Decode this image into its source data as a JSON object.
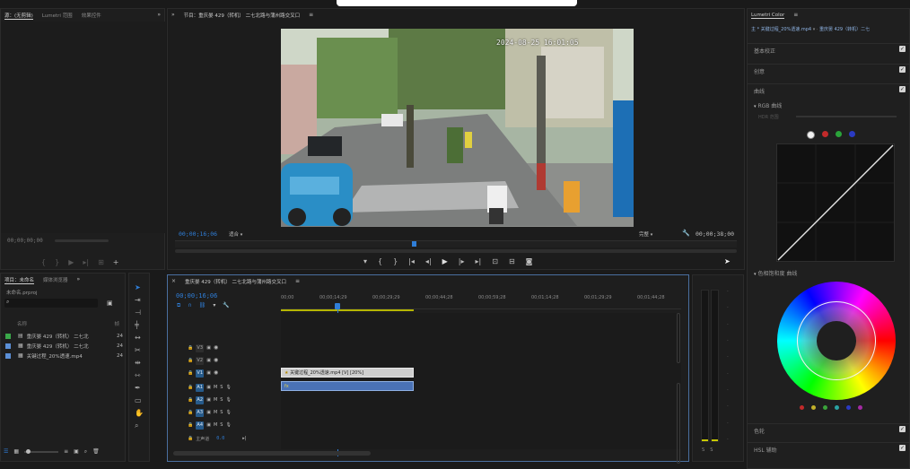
{
  "source_panel": {
    "tabs": [
      "源：(无剪辑)",
      "Lumetri 范围",
      "效果控件"
    ],
    "timecode": "00;00;00;00"
  },
  "program": {
    "title": "节目：重庆晏 429（转机） 二七北路与蒲州路交叉口 ",
    "timecode_left": "00;00;16;06",
    "fit": "适合",
    "quality": "完整",
    "timecode_right": "00;00;38;00",
    "video_overlay_time": "2024-08-25 16:01:05"
  },
  "project": {
    "tabs": [
      "项目：未命名",
      "媒体浏览器"
    ],
    "file": "未命名.prproj",
    "search_placeholder": "",
    "col_name": "名称",
    "col_rate": "帧",
    "items": [
      {
        "color": "#3aa84a",
        "name": "重庆晏 429（转机） 二七北",
        "rate": "24"
      },
      {
        "color": "#5b8fd6",
        "name": "重庆晏 429（转机） 二七北",
        "rate": "24"
      },
      {
        "color": "#5b8fd6",
        "name": "关键过程_20%透速.mp4",
        "rate": "24"
      }
    ]
  },
  "timeline": {
    "title": "重庆晏 429（转机） 二七北路与蒲州路交叉口 ",
    "timecode": "00;00;16;06",
    "ticks": [
      "00;00",
      "00;00;14;29",
      "00;00;29;29",
      "00;00;44;28",
      "00;00;59;28",
      "00;01;14;28",
      "00;01;29;29",
      "00;01;44;28"
    ],
    "video_tracks": [
      "V3",
      "V2",
      "V1"
    ],
    "audio_tracks": [
      "A1",
      "A2",
      "A3",
      "A4"
    ],
    "clip_label": "关键过程_20%透速.mp4 [V] [20%]",
    "audio_clip_label": "fx",
    "mix_label": "主声道",
    "mix_value": "0.0"
  },
  "lumetri": {
    "panel_title": "Lumetri Color",
    "source_label": "主 * 关键过程_20%透速.mp4",
    "sequence_label": "重庆晏 429（转机）二七",
    "basic_correction": "基本校正",
    "creative": "创意",
    "curves": "曲线",
    "rgb_curves": "RGB 曲线",
    "hdr_range": "HDR 范围",
    "hue_sat": "色相饱和度 曲线",
    "color_wheels": "色轮",
    "hsl_secondary": "HSL 辅助"
  },
  "colors": {
    "accent_blue": "#2f7ed8",
    "clip_fill": "#cfcfcf",
    "audio_clip": "#4a72b6",
    "work_area": "#b5b500"
  }
}
